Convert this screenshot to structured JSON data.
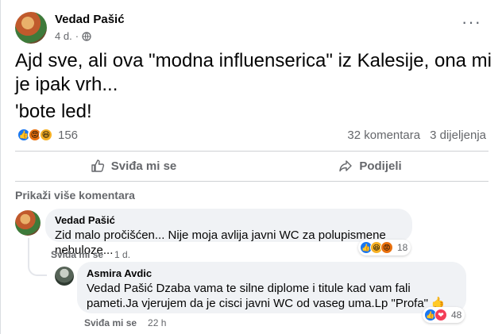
{
  "post": {
    "author": "Vedad Pašić",
    "time": "4 d.",
    "privacy_icon": "globe-icon",
    "more_icon": "more-dots-icon",
    "text_line1": "Ajd sve, ali ova \"modna influenserica\" iz Kalesije, ona mi je ipak vrh...",
    "text_line2": "'bote led!",
    "reaction_icons": [
      "like-icon",
      "angry-icon",
      "haha-icon"
    ],
    "reaction_count": "156",
    "comments_count": "32 komentara",
    "shares_count": "3 dijeljenja"
  },
  "actions": {
    "like_label": "Sviđa mi se",
    "share_label": "Podijeli"
  },
  "comments_section": {
    "view_more": "Prikaži više komentara",
    "comments": [
      {
        "author": "Vedad Pašić",
        "text": "Zid malo pročišćen... Nije moja avlija javni WC za polupismene nebuloze...",
        "like_label": "Sviđa mi se",
        "time": "1 d.",
        "reaction_count": "18"
      },
      {
        "author": "Asmira Avdic",
        "text": "Vedad Pašić Dzaba vama te silne diplome i titule kad vam fali pameti.Ja vjerujem da je cisci javni WC od vaseg uma.Lp \"Profa\" 🤙",
        "like_label": "Sviđa mi se",
        "time": "22 h",
        "reaction_count": "48"
      }
    ]
  },
  "colors": {
    "like_blue": "#1877f2",
    "secondary_text": "#65676b",
    "bubble_bg": "#f0f2f5"
  }
}
